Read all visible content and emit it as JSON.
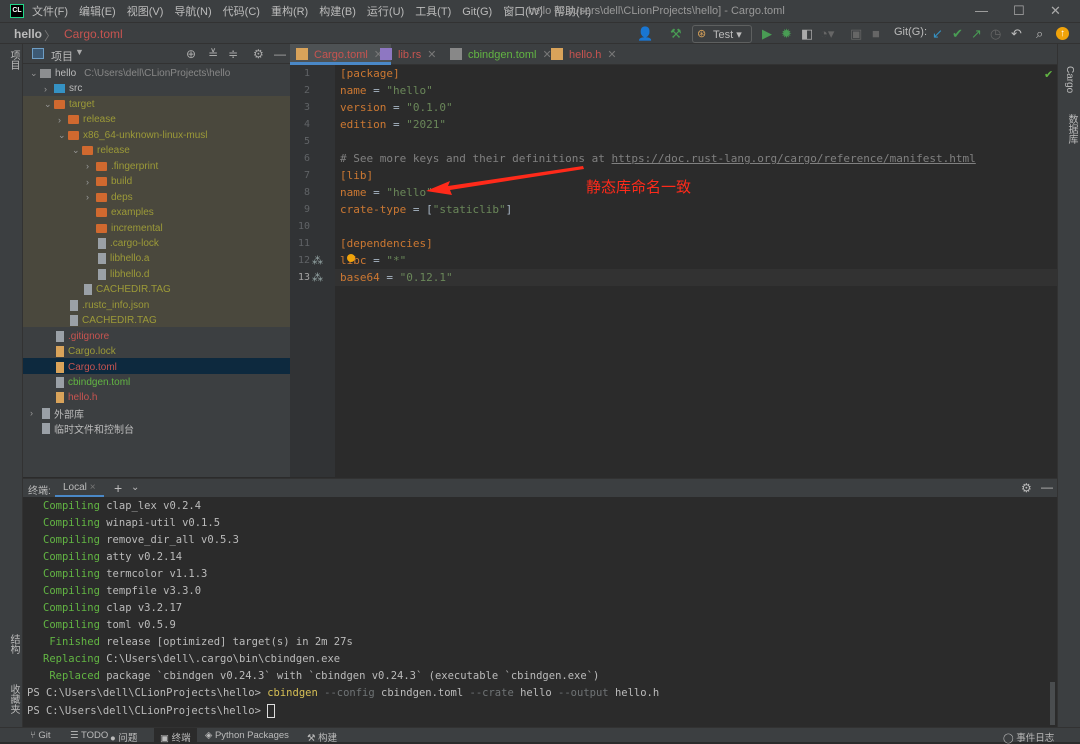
{
  "titlebar": {
    "logo": "CL",
    "menu": [
      "文件(F)",
      "编辑(E)",
      "视图(V)",
      "导航(N)",
      "代码(C)",
      "重构(R)",
      "构建(B)",
      "运行(U)",
      "工具(T)",
      "Git(G)",
      "窗口(W)",
      "帮助(H)"
    ],
    "title": "hello [C:\\Users\\dell\\CLionProjects\\hello] - Cargo.toml"
  },
  "navbar": {
    "project": "hello",
    "file": "Cargo.toml",
    "run_config": "Test",
    "git_label": "Git(G):"
  },
  "left_strip": {
    "top": "项目",
    "structure": "结构",
    "favorites": "收藏夹"
  },
  "right_strip": {
    "cargo": "Cargo",
    "database": "数据库"
  },
  "project_panel": {
    "title": "项目",
    "tree": [
      {
        "label": "hello",
        "path": "C:\\Users\\dell\\CLionProjects\\hello",
        "depth": 0,
        "expanded": true,
        "icon": "folder-grey",
        "color": "grey"
      },
      {
        "label": "src",
        "depth": 1,
        "expanded": false,
        "icon": "folder-blue",
        "color": "grey"
      },
      {
        "label": "target",
        "depth": 1,
        "expanded": true,
        "icon": "folder-orange",
        "color": "olive"
      },
      {
        "label": "release",
        "depth": 2,
        "expanded": false,
        "icon": "folder-orange",
        "color": "olive"
      },
      {
        "label": "x86_64-unknown-linux-musl",
        "depth": 2,
        "expanded": true,
        "icon": "folder-orange",
        "color": "olive"
      },
      {
        "label": "release",
        "depth": 3,
        "expanded": true,
        "icon": "folder-orange",
        "color": "olive"
      },
      {
        "label": ".fingerprint",
        "depth": 4,
        "expanded": false,
        "icon": "folder-orange",
        "color": "olive"
      },
      {
        "label": "build",
        "depth": 4,
        "expanded": false,
        "icon": "folder-orange",
        "color": "olive"
      },
      {
        "label": "deps",
        "depth": 4,
        "expanded": false,
        "icon": "folder-orange",
        "color": "olive"
      },
      {
        "label": "examples",
        "depth": 4,
        "icon": "folder-orange",
        "color": "olive"
      },
      {
        "label": "incremental",
        "depth": 4,
        "icon": "folder-orange",
        "color": "olive"
      },
      {
        "label": ".cargo-lock",
        "depth": 4,
        "icon": "file",
        "color": "olive"
      },
      {
        "label": "libhello.a",
        "depth": 4,
        "icon": "file",
        "color": "olive"
      },
      {
        "label": "libhello.d",
        "depth": 4,
        "icon": "file",
        "color": "olive"
      },
      {
        "label": "CACHEDIR.TAG",
        "depth": 3,
        "icon": "file",
        "color": "olive"
      },
      {
        "label": ".rustc_info.json",
        "depth": 2,
        "icon": "file",
        "color": "olive"
      },
      {
        "label": "CACHEDIR.TAG",
        "depth": 2,
        "icon": "file",
        "color": "olive"
      },
      {
        "label": ".gitignore",
        "depth": 1,
        "icon": "file",
        "color": "red"
      },
      {
        "label": "Cargo.lock",
        "depth": 1,
        "icon": "cargo-file",
        "color": "olive"
      },
      {
        "label": "Cargo.toml",
        "depth": 1,
        "icon": "cargo-file",
        "color": "red",
        "selected": true
      },
      {
        "label": "cbindgen.toml",
        "depth": 1,
        "icon": "file",
        "color": "green"
      },
      {
        "label": "hello.h",
        "depth": 1,
        "icon": "header-file",
        "color": "red"
      },
      {
        "label": "外部库",
        "depth": 0,
        "expanded": false,
        "icon": "library",
        "color": "grey"
      },
      {
        "label": "临时文件和控制台",
        "depth": 0,
        "icon": "scratch",
        "color": "grey"
      }
    ]
  },
  "editor": {
    "tabs": [
      {
        "label": "Cargo.toml",
        "color": "#c75450",
        "active": true
      },
      {
        "label": "lib.rs",
        "color": "#c75450"
      },
      {
        "label": "cbindgen.toml",
        "color": "#62b543"
      },
      {
        "label": "hello.h",
        "color": "#c75450"
      }
    ],
    "lines": [
      [
        [
          "[package]",
          "k"
        ]
      ],
      [
        [
          "name",
          "k"
        ],
        [
          " = ",
          "p"
        ],
        [
          "\"hello\"",
          "s"
        ]
      ],
      [
        [
          "version",
          "k"
        ],
        [
          " = ",
          "p"
        ],
        [
          "\"0.1.0\"",
          "s"
        ]
      ],
      [
        [
          "edition",
          "k"
        ],
        [
          " = ",
          "p"
        ],
        [
          "\"2021\"",
          "s"
        ]
      ],
      [],
      [
        [
          "# See more keys and their definitions at ",
          "c"
        ],
        [
          "https://doc.rust-lang.org/cargo/reference/manifest.html",
          "u"
        ]
      ],
      [
        [
          "[lib]",
          "k"
        ]
      ],
      [
        [
          "name",
          "k"
        ],
        [
          " = ",
          "p"
        ],
        [
          "\"hello\"",
          "s"
        ]
      ],
      [
        [
          "crate-type",
          "k"
        ],
        [
          " = ",
          "p"
        ],
        [
          "[",
          "p"
        ],
        [
          "\"staticlib\"",
          "s"
        ],
        [
          "]",
          "p"
        ]
      ],
      [],
      [
        [
          "[dependencies]",
          "k"
        ]
      ],
      [
        [
          "libc",
          "k"
        ],
        [
          " = ",
          "p"
        ],
        [
          "\"*\"",
          "s"
        ]
      ],
      [
        [
          "base64",
          "k"
        ],
        [
          " = ",
          "p"
        ],
        [
          "\"0.12.1\"",
          "s"
        ]
      ]
    ],
    "annotation": "静态库命名一致",
    "annotation_color": "#ff2a1a"
  },
  "terminal": {
    "label": "终端:",
    "tab": "Local",
    "lines": [
      {
        "status": "Compiling",
        "text": "clap_lex v0.2.4"
      },
      {
        "status": "Compiling",
        "text": "winapi-util v0.1.5"
      },
      {
        "status": "Compiling",
        "text": "remove_dir_all v0.5.3"
      },
      {
        "status": "Compiling",
        "text": "atty v0.2.14"
      },
      {
        "status": "Compiling",
        "text": "termcolor v1.1.3"
      },
      {
        "status": "Compiling",
        "text": "tempfile v3.3.0"
      },
      {
        "status": "Compiling",
        "text": "clap v3.2.17"
      },
      {
        "status": "Compiling",
        "text": "toml v0.5.9"
      },
      {
        "status": " Finished",
        "text": "release [optimized] target(s) in 2m 27s"
      },
      {
        "status": "Replacing",
        "text": "C:\\Users\\dell\\.cargo\\bin\\cbindgen.exe"
      },
      {
        "status": " Replaced",
        "text": "package `cbindgen v0.24.3` with `cbindgen v0.24.3` (executable `cbindgen.exe`)"
      }
    ],
    "prompt": "PS C:\\Users\\dell\\CLionProjects\\hello> ",
    "command": [
      [
        "cbindgen",
        "ty"
      ],
      [
        " --config ",
        "td"
      ],
      [
        "cbindgen.toml",
        ""
      ],
      [
        " --crate ",
        "td"
      ],
      [
        "hello",
        ""
      ],
      [
        " --output ",
        "td"
      ],
      [
        "hello.h",
        ""
      ]
    ]
  },
  "bottom_bar": {
    "items": [
      "Git",
      "TODO",
      "问题",
      "终端",
      "Python Packages",
      "构建"
    ],
    "active": "终端",
    "event_log": "事件日志"
  }
}
